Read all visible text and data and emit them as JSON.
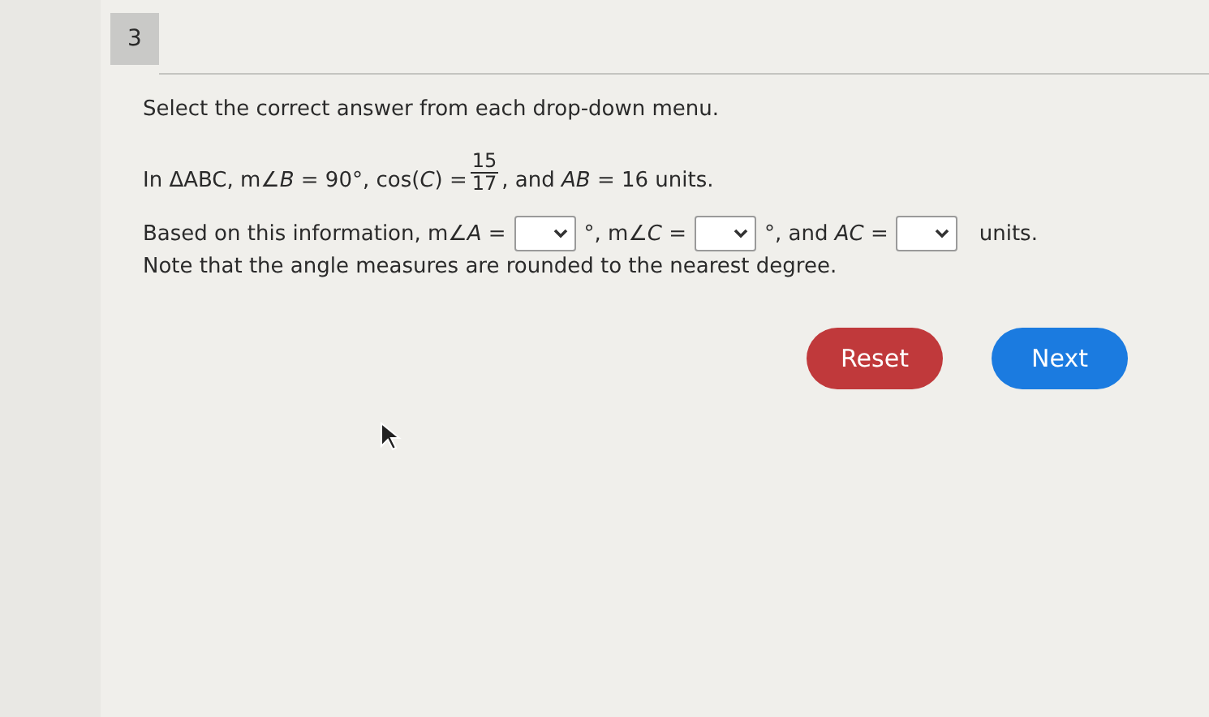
{
  "question_number": "3",
  "instruction": "Select the correct answer from each drop-down menu.",
  "problem": {
    "before": "In ΔABC, m∠*B* = 90°, cos(*C*) = ",
    "numerator": "15",
    "denominator": "17",
    "after": ", and *AB* = 16 units."
  },
  "answer_parts": [
    {
      "kind": "text",
      "text": "Based on this information, m∠*A* ="
    },
    {
      "kind": "dropdown"
    },
    {
      "kind": "text",
      "text": "°, m∠*C* ="
    },
    {
      "kind": "dropdown"
    },
    {
      "kind": "text",
      "text": "°, and *AC* ="
    },
    {
      "kind": "dropdown"
    },
    {
      "kind": "text",
      "text": "units."
    }
  ],
  "note": "Note that the angle measures are rounded to the nearest degree.",
  "buttons": [
    {
      "label": "Reset",
      "kind": "reset"
    },
    {
      "label": "Next",
      "kind": "next"
    }
  ]
}
